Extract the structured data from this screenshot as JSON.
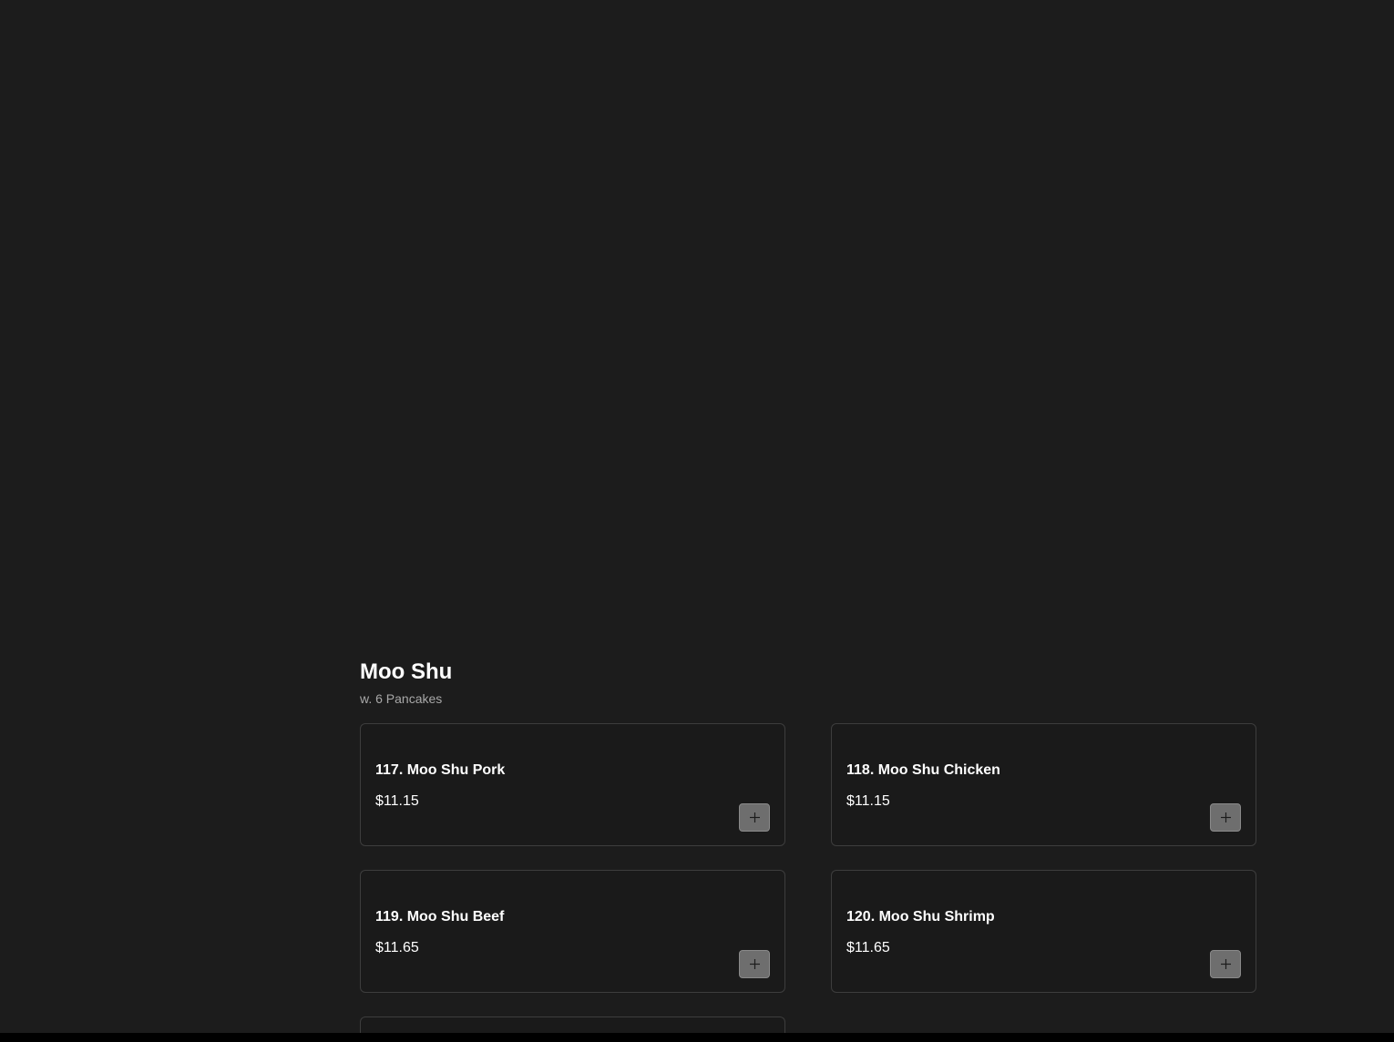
{
  "section": {
    "title": "Moo Shu",
    "subtitle": "w. 6 Pancakes"
  },
  "items": [
    {
      "name": "117. Moo Shu Pork",
      "price": "$11.15"
    },
    {
      "name": "118. Moo Shu Chicken",
      "price": "$11.15"
    },
    {
      "name": "119. Moo Shu Beef",
      "price": "$11.65"
    },
    {
      "name": "120. Moo Shu Shrimp",
      "price": "$11.65"
    }
  ],
  "icons": {
    "add": "plus-icon"
  },
  "colors": {
    "background": "#1c1c1c",
    "card_border": "#3d3d3d",
    "button": "#6e6e6e",
    "subtitle": "#a8a8a8"
  }
}
